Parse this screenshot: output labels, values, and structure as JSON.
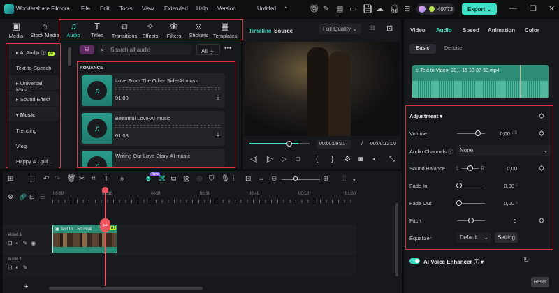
{
  "app": {
    "title": "Wondershare Filmora",
    "project": "Untitled",
    "credits": "49773",
    "export": "Export"
  },
  "menu": [
    "File",
    "Edit",
    "Tools",
    "View",
    "Extended",
    "Help",
    "Version"
  ],
  "toolbar": [
    "Media",
    "Stock Media",
    "Audio",
    "Titles",
    "Transitions",
    "Effects",
    "Filters",
    "Stickers",
    "Templates"
  ],
  "categories": [
    "AI Audio",
    "Text-to-Speech",
    "Universal Musi...",
    "Sound Effect",
    "Music",
    "Trending",
    "Vlog",
    "Happy & Uplif..."
  ],
  "ai_badge": "AI",
  "search": {
    "placeholder": "Search all audio",
    "filter": "All"
  },
  "section": "ROMANCE",
  "audio_items": [
    {
      "name": "Love From The Other Side-AI music",
      "duration": "01:03"
    },
    {
      "name": "Beautiful Love-AI music",
      "duration": "01:08"
    },
    {
      "name": "Writing Our Love Story-AI music",
      "duration": ""
    }
  ],
  "preview": {
    "tab_timeline": "Timeline",
    "tab_source": "Source",
    "quality": "Full Quality",
    "current": "00:00:09:21",
    "sep": "/",
    "total": "00:00:12:00",
    "progress": 0.8
  },
  "right": {
    "tabs": [
      "Video",
      "Audio",
      "Speed",
      "Animation",
      "Color"
    ],
    "subtabs": [
      "Basic",
      "Denoise"
    ],
    "clip": "Text to Video_20...-15 18-37-50.mp4",
    "adjustment": "Adjustment",
    "volume": {
      "label": "Volume",
      "value": "0,00",
      "unit": "dB"
    },
    "channels": {
      "label": "Audio Channels",
      "value": "None"
    },
    "balance": {
      "label": "Sound Balance",
      "l": "L",
      "r": "R",
      "value": "0,00"
    },
    "fadein": {
      "label": "Fade In",
      "value": "0,00",
      "unit": "s"
    },
    "fadeout": {
      "label": "Fade Out",
      "value": "0,00",
      "unit": "s"
    },
    "pitch": {
      "label": "Pitch",
      "value": "0"
    },
    "equalizer": {
      "label": "Equalizer",
      "value": "Default",
      "setting": "Setting"
    },
    "enhancer": "AI Voice Enhancer",
    "reset": "Reset"
  },
  "timeline": {
    "ticks": [
      "00:00",
      "00:10",
      "00:20",
      "00:30",
      "00:40",
      "00:50",
      "01:00"
    ],
    "video_track": "Video 1",
    "audio_track": "Audio 1",
    "clip": "Text to...-50.mp4",
    "clip_badge": "AI",
    "new_badge": "New"
  }
}
